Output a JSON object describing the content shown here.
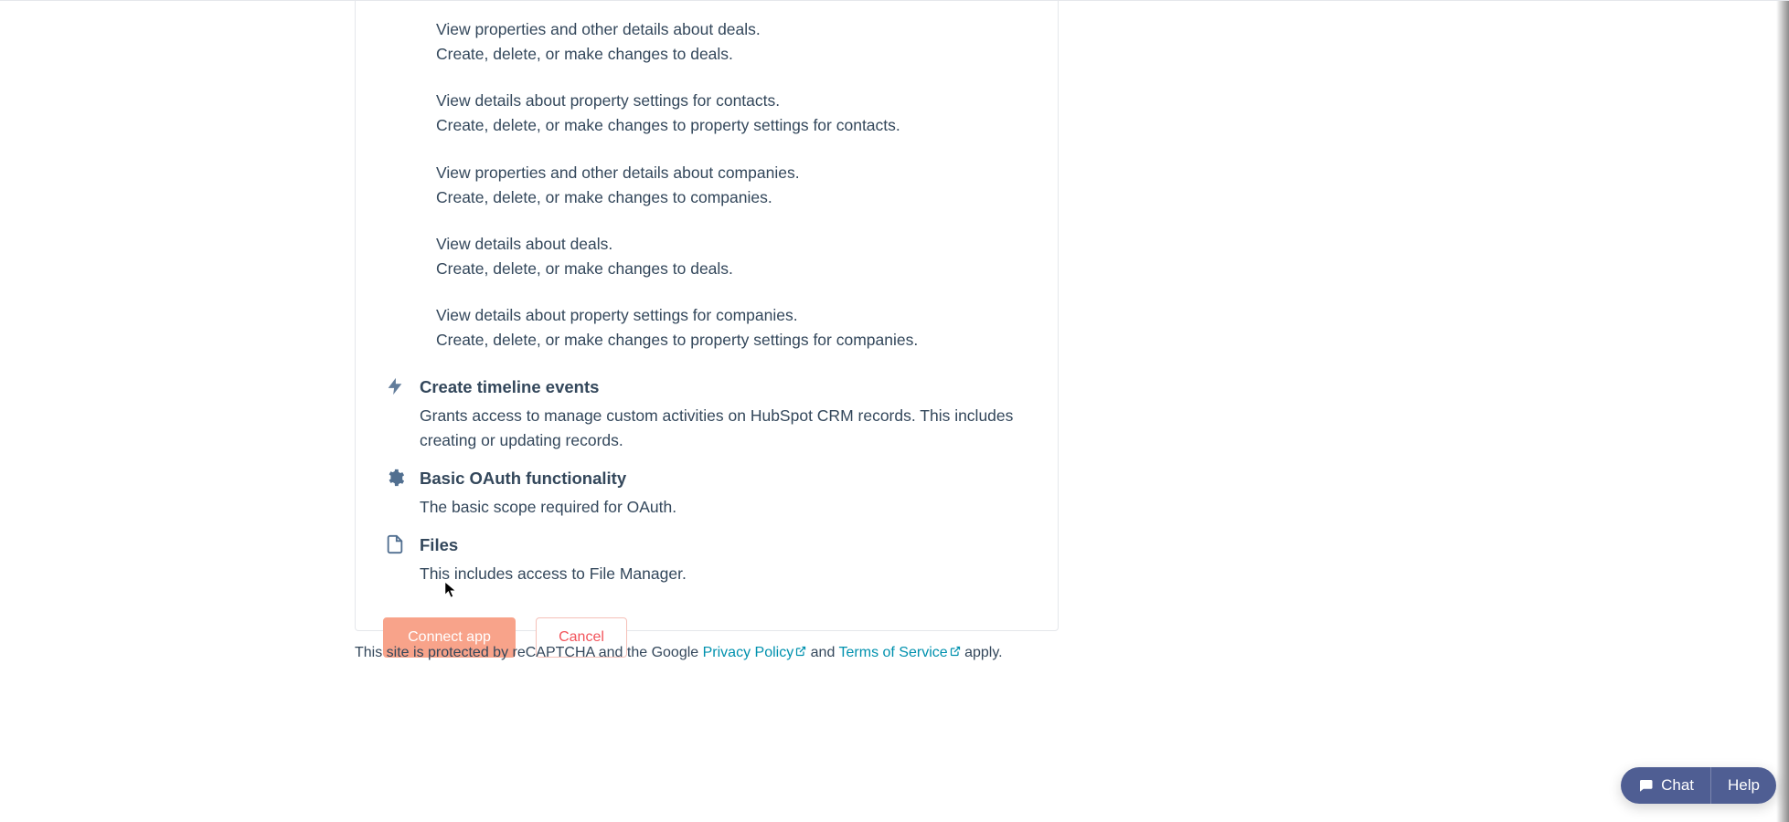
{
  "permissions": {
    "groups": [
      {
        "view": "View properties and other details about deals.",
        "edit": "Create, delete, or make changes to deals."
      },
      {
        "view": "View details about property settings for contacts.",
        "edit": "Create, delete, or make changes to property settings for contacts."
      },
      {
        "view": "View properties and other details about companies.",
        "edit": "Create, delete, or make changes to companies."
      },
      {
        "view": "View details about deals.",
        "edit": "Create, delete, or make changes to deals."
      },
      {
        "view": "View details about property settings for companies.",
        "edit": "Create, delete, or make changes to property settings for companies."
      }
    ]
  },
  "sections": {
    "timeline": {
      "title": "Create timeline events",
      "desc": "Grants access to manage custom activities on HubSpot CRM records. This includes creating or updating records."
    },
    "oauth": {
      "title": "Basic OAuth functionality",
      "desc": "The basic scope required for OAuth."
    },
    "files": {
      "title": "Files",
      "desc": "This includes access to File Manager."
    }
  },
  "actions": {
    "connect": "Connect app",
    "cancel": "Cancel"
  },
  "footer": {
    "prefix": "This site is protected by reCAPTCHA and the Google ",
    "privacy": "Privacy Policy",
    "and": " and ",
    "terms": "Terms of Service",
    "suffix": " apply."
  },
  "widgets": {
    "chat": "Chat",
    "help": "Help"
  }
}
